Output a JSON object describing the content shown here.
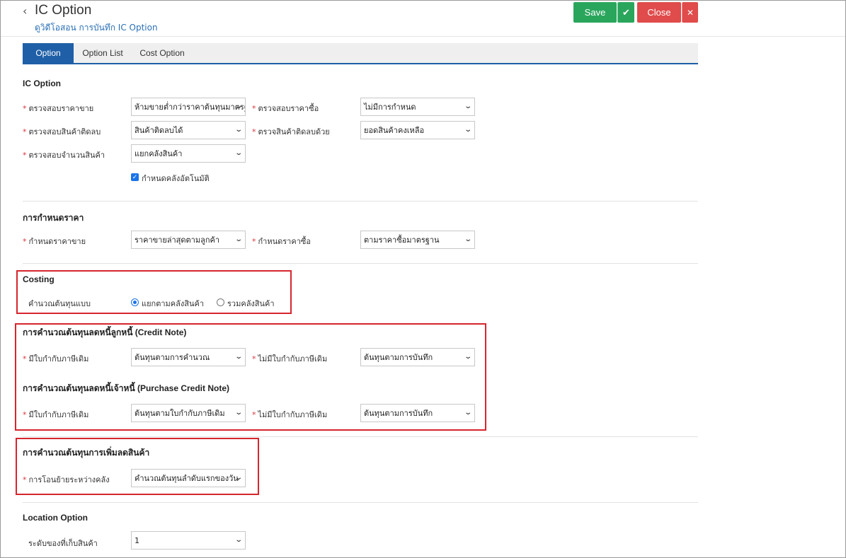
{
  "header": {
    "title": "IC Option",
    "subtitle": "ดูวิดีโอสอน การบันทึก IC Option",
    "save_label": "Save",
    "close_label": "Close",
    "check_glyph": "✔",
    "x_glyph": "✕",
    "back_glyph": "‹"
  },
  "tabs": [
    {
      "label": "Option",
      "active": true
    },
    {
      "label": "Option List",
      "active": false
    },
    {
      "label": "Cost Option",
      "active": false
    }
  ],
  "ic_option": {
    "title": "IC Option",
    "sell_price_check_label": "ตรวจสอบราคาขาย",
    "sell_price_check_value": "ห้ามขายต่ำกว่าราคาต้นทุนมาตรฐาน",
    "buy_price_check_label": "ตรวจสอบราคาซื้อ",
    "buy_price_check_value": "ไม่มีการกำหนด",
    "negative_stock_label": "ตรวจสอบสินค้าติดลบ",
    "negative_stock_value": "สินค้าติดลบได้",
    "negative_stock_by_label": "ตรวจสินค้าติดลบด้วย",
    "negative_stock_by_value": "ยอดสินค้าคงเหลือ",
    "qty_check_label": "ตรวจสอบจำนวนสินค้า",
    "qty_check_value": "แยกคลังสินค้า",
    "auto_warehouse_label": "กำหนดคลังอัตโนมัติ",
    "auto_warehouse_checked": true
  },
  "pricing": {
    "title": "การกำหนดราคา",
    "sell_price_label": "กำหนดราคาขาย",
    "sell_price_value": "ราคาขายล่าสุดตามลูกค้า",
    "buy_price_label": "กำหนดราคาซื้อ",
    "buy_price_value": "ตามราคาซื้อมาตรฐาน"
  },
  "costing": {
    "title": "Costing",
    "method_label": "คำนวณต้นทุนแบบ",
    "option_separate": "แยกตามคลังสินค้า",
    "option_combined": "รวมคลังสินค้า",
    "selected": "separate"
  },
  "credit_note": {
    "title": "การคำนวณต้นทุนลดหนี้ลูกหนี้ (Credit Note)",
    "with_invoice_label": "มีใบกำกับภาษีเดิม",
    "with_invoice_value": "ต้นทุนตามการคำนวณ",
    "without_invoice_label": "ไม่มีใบกำกับภาษีเดิม",
    "without_invoice_value": "ต้นทุนตามการบันทึก"
  },
  "purchase_credit_note": {
    "title": "การคำนวณต้นทุนลดหนี้เจ้าหนี้ (Purchase Credit Note)",
    "with_invoice_label": "มีใบกำกับภาษีเดิม",
    "with_invoice_value": "ต้นทุนตามใบกำกับภาษีเดิม",
    "without_invoice_label": "ไม่มีใบกำกับภาษีเดิม",
    "without_invoice_value": "ต้นทุนตามการบันทึก"
  },
  "adjust": {
    "title": "การคำนวณต้นทุนการเพิ่มลดสินค้า",
    "transfer_label": "การโอนย้ายระหว่างคลัง",
    "transfer_value": "คำนวณต้นทุนลำดับแรกของวัน"
  },
  "location": {
    "title": "Location Option",
    "level_label": "ระดับของที่เก็บสินค้า",
    "level_value": "1"
  },
  "colors": {
    "save": "#2aa65c",
    "close": "#e04b4b",
    "tab_active": "#1f5fa7",
    "required": "#d9363e",
    "highlight_box": "#d7252d"
  },
  "icons": {
    "back": "chevron-left-icon",
    "save_dropdown": "check-icon",
    "close_dropdown": "x-icon",
    "select_arrow": "chevron-down-icon"
  }
}
